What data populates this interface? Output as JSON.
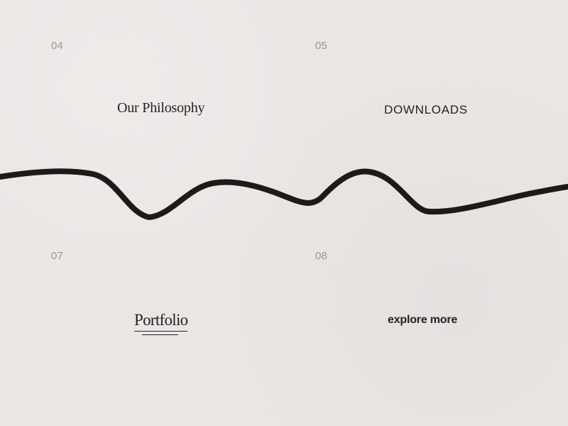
{
  "background_color": "#ebe6e4",
  "items": [
    {
      "index": "04",
      "label": "Our Philosophy"
    },
    {
      "index": "05",
      "label": "DOWNLOADS"
    },
    {
      "index": "07",
      "label": "Portfolio"
    },
    {
      "index": "08",
      "label": "explore more"
    }
  ],
  "decoration": {
    "wave_line_color": "#1d1a18"
  }
}
